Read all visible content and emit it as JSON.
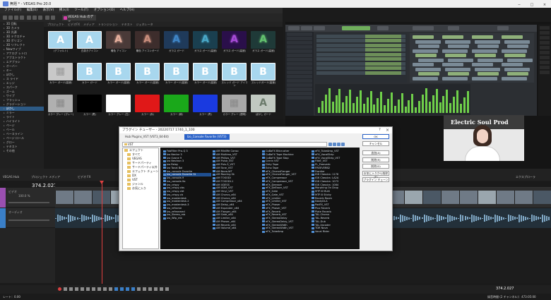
{
  "window": {
    "title": "無題 * - VEGAS Pro 20.0"
  },
  "menu": [
    "ファイル(F)",
    "編集(E)",
    "表示(V)",
    "挿入(I)",
    "ツール(T)",
    "オプション(O)",
    "ヘルプ(H)"
  ],
  "toolbar": {
    "vegas_hub": "VEGAS Hub のデモ"
  },
  "media_tabs": [
    "プロジェクト",
    "ビデオFX",
    "メディア",
    "トランジション",
    "テキスト",
    "ジェネレータ"
  ],
  "effects_tree": [
    "3D 回転",
    "3D カメラ",
    "3D 光源",
    "3D テクスチャ",
    "3D ポリゴン",
    "3D リフレクト",
    "Newワイプ",
    "アナログ レトロ",
    "アブストラクト",
    "エアブラシ",
    "オーバー",
    "キー",
    "ぼかし",
    "ス ライド",
    "エッジ",
    "スパーク",
    "ズーム",
    "ワイプ",
    "フラッシュ",
    "グラデーション",
    "ぼかし",
    "ミラー",
    "ライト",
    "ハイライト",
    "ページ",
    "ベール",
    "ベースライン",
    "ページ ロール",
    "グロー",
    "テキスト",
    "その他"
  ],
  "effects_tree_selected": 20,
  "thumbnails": [
    {
      "label": "(デフォルト)",
      "bg": "#a8d7ee",
      "fg": "#ffffff",
      "glyph": "A"
    },
    {
      "label": "白抜きアイコン",
      "bg": "#a8d7ee",
      "fg": "#ffffff",
      "glyph": "A"
    },
    {
      "label": "暖色 アイコン",
      "bg": "#4a3a38",
      "fg": "#e7b09e",
      "glyph": "A"
    },
    {
      "label": "暖色 アイコンガード",
      "bg": "#3d2d2c",
      "fg": "#c98d7c",
      "glyph": "A"
    },
    {
      "label": "ガラス ガード",
      "bg": "#1f3a5a",
      "fg": "#3f86c7",
      "glyph": "A"
    },
    {
      "label": "ガラス ガード(高速)",
      "bg": "#1a3f4f",
      "fg": "#49a8c8",
      "glyph": "A"
    },
    {
      "label": "ガラス ガード(高速)",
      "bg": "#2a0f4a",
      "fg": "#a84cd8",
      "glyph": "A"
    },
    {
      "label": "ガラス ガード(高速)",
      "bg": "#1f3a38",
      "fg": "#63c26f",
      "glyph": "A"
    },
    {
      "label": "カラー ガード(高速)",
      "bg": "#c8c8c8",
      "fg": "#999999",
      "glyph": "▦"
    },
    {
      "label": "カラー ガード",
      "bg": "#a8d7ee",
      "fg": "#ffffff",
      "glyph": "B"
    },
    {
      "label": "カラー ガード(高速)",
      "bg": "#a8d7ee",
      "fg": "#ffffff",
      "glyph": "B"
    },
    {
      "label": "カラー ガード(高速)",
      "bg": "#a8d7ee",
      "fg": "#ffffff",
      "glyph": "B"
    },
    {
      "label": "カラー ガード(高速)",
      "bg": "#a8d7ee",
      "fg": "#ffffff",
      "glyph": "B"
    },
    {
      "label": "カラー ガード(高速)",
      "bg": "#a8d7ee",
      "fg": "#ffffff",
      "glyph": "B"
    },
    {
      "label": "スレッド ガード アイコン",
      "bg": "#a8d7ee",
      "fg": "#ffffff",
      "glyph": "B"
    },
    {
      "label": "スレッドガード(高速)",
      "bg": "#a8d7ee",
      "fg": "#ffffff",
      "glyph": "B"
    },
    {
      "label": "カラー グレー (グレー)",
      "bg": "#b0b0b0",
      "fg": "#888888",
      "glyph": "▦"
    },
    {
      "label": "カラー (黒)",
      "bg": "#000000",
      "fg": "#000000",
      "glyph": ""
    },
    {
      "label": "カラー グレー (白)",
      "bg": "#ffffff",
      "fg": "#ffffff",
      "glyph": ""
    },
    {
      "label": "カラー (赤)",
      "bg": "#e01818",
      "fg": "#e01818",
      "glyph": ""
    },
    {
      "label": "カラー (緑)",
      "bg": "#1aa81a",
      "fg": "#1aa81a",
      "glyph": ""
    },
    {
      "label": "カラー (青)",
      "bg": "#1a3ae0",
      "fg": "#1a3ae0",
      "glyph": ""
    },
    {
      "label": "カラー グレー (透明)",
      "bg": "#a8a8a8",
      "fg": "#888888",
      "glyph": "▦"
    },
    {
      "label": "ぼかし ガード",
      "bg": "#c0c8c0",
      "fg": "#6a7a6a",
      "glyph": "A"
    }
  ],
  "preview": {
    "banner": "Electric Soul Prod"
  },
  "time_panel": {
    "frame_label": "フレーム：",
    "frame_value": "22,379",
    "size_label": "表示：",
    "size_value": "1080x1920x32"
  },
  "midbar": {
    "left_text": "VEGAS Hub",
    "tab2": "プロジェクト メディア",
    "tab3": "ビデオ FX",
    "right": "エクスプローラ"
  },
  "timeline": {
    "timecode": "374.2.027",
    "track1": "ビデオ",
    "track2": "オーディオ",
    "level": "100.0 %"
  },
  "status": {
    "left": "レート：0.00",
    "right_time": "374.2.027",
    "right_rec": "録音時間 (2 チャンネル)：473:05:00"
  },
  "dialog": {
    "title": "プラグイン チューザー - 20220717 1740_1_100",
    "tabs": [
      "Hub Plugins_VST (VST3_64-Bit)",
      "Izo_Console Favorite (VST3)"
    ],
    "active_tab": 1,
    "path": "VST",
    "tree": [
      "エフェクト",
      "すべて",
      "VEGAS",
      "サードパーティ",
      "サードパーティ以外",
      "エフェクト チェーン",
      "DX",
      "VST",
      "ジャンル",
      "お気に入り"
    ],
    "buttons": [
      "OK",
      "キャンセル",
      "追加(A)",
      "削除(R)",
      "削除(D)",
      "お気に入りから削除(F)",
      "プラグイン チェーン"
    ],
    "columns": [
      [
        "FabFilter Pro-Q 3",
        "Izo Nectar 3",
        "Izo Ozone 9",
        "Izo Neutron 3",
        "Izo Relay",
        "Izo Tonal Bal",
        "Izo_console Favorite",
        "Izo_console Favorite St",
        "Izo_console-9",
        "Izo_console-9a",
        "Izo_crispy",
        "Izo_crispy-cbs",
        "Izo_crispy-cbt",
        "Izo_crispy-cb",
        "Izo_masterdesk",
        "Izo_masterdesk-2",
        "Izo_masterdesk-3",
        "Izo_reframe",
        "Izo_refreamed",
        "Izo_Stereo_mb",
        "Izo_Wtp_mb"
      ],
      [
        "AM MiniMe Conso",
        "AM Multimo_VST",
        "AM Philips_VST",
        "AM Pulse_VST",
        "AM Puls-3_VST",
        "AM Tone_VST",
        "AM Nova.WT",
        "AM Roaring Sk",
        "AM TOSODI",
        "AM TOSODI-1",
        "AM UDESS",
        "AM UDM_VST",
        "AM Vinyl_VST",
        "AM Chorus_x64",
        "AM Chorus_x64",
        "AM Compressor_x64",
        "AM Delay_x64",
        "AM Expander_x64",
        "AM Flanger_x64",
        "AM Gate_x64",
        "AM Limiter_x64",
        "AM Phaser_x64",
        "AM Reverb_x64",
        "AM Volume_x64"
      ],
      [
        "CoBaFX Bitcrusher",
        "CoBaFX Tape Machine",
        "CoBaFX Tape Stop",
        "Cerrin VST",
        "Dirty Tape",
        "Echo Tape",
        "eFX_ChorusFlanger",
        "eFX_ChorusFlanger_VST",
        "eFX_Compressor",
        "eFX_Compressor_VST",
        "eFX_Deesser",
        "eFX_DeEsser_VST",
        "eFX_Gate",
        "eFX_Gate_VST",
        "eFX_Limiter",
        "eFX_Limiter_VST",
        "eFX_Phaser",
        "eFX_Phaser_VST",
        "eFX_Reverb",
        "eFX_Reverb_VST",
        "eFX_StereoDelay",
        "eFX_StereoDelay_VST",
        "eFX_StereoWidth",
        "eFX_StereoWidth_VST",
        "eFX_TubeAmp"
      ],
      [
        "eFX_TubeAmp_VST",
        "eFX_VocalStrip",
        "eFX_VocalStrip_VST",
        "Filter_VST",
        "FL_Freeverb",
        "FREEVERB2",
        "Frontier",
        "IGK Classics: 1176",
        "IGK Classics: LA2A",
        "IGK Classics: 1073",
        "IGK Classics: 1084",
        "Morphing On Drop",
        "MTP-8 Multi",
        "MTP-8 Sticky",
        "Reverb Room",
        "NastyDLA",
        "PadFX_VST",
        "Pico Reverb",
        "Plate Reverb",
        "TAL-Chorus",
        "TAL-Reverb",
        "TAL-Dub",
        "TAL-Vocoder",
        "TDR Nova",
        "Vocal Rider"
      ]
    ],
    "selected_item": "Izo_console Favorite St"
  },
  "colors": {
    "accent": "#2a62c8",
    "playhead": "#e04040",
    "hub": "#d23ea8"
  }
}
